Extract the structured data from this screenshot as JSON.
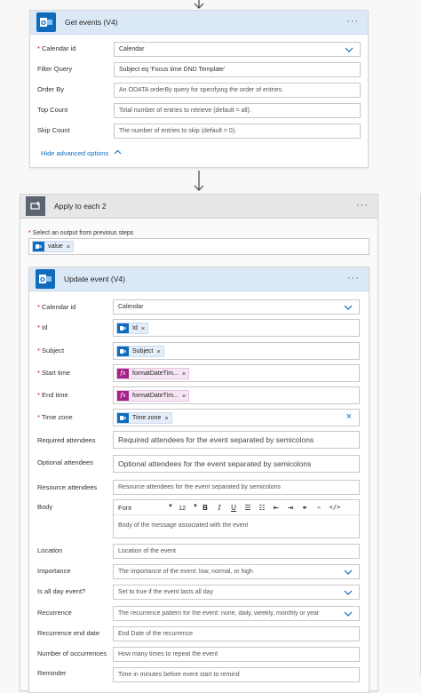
{
  "get_events": {
    "title": "Get events (V4)",
    "fields": [
      {
        "label": "Calendar id",
        "required": true,
        "value": "Calendar"
      },
      {
        "label": "Filter Query",
        "value": "Subject eq 'Focus time DND Template'"
      },
      {
        "label": "Order By",
        "placeholder": "An ODATA orderBy query for specifying the order of entries."
      },
      {
        "label": "Top Count",
        "placeholder": "Total number of entries to retrieve (default = all)."
      },
      {
        "label": "Skip Count",
        "placeholder": "The number of entries to skip (default = 0)."
      }
    ],
    "hide_advanced": "Hide advanced options"
  },
  "apply_each": {
    "title": "Apply to each 2",
    "select_label": "Select an output from previous steps",
    "token": "value"
  },
  "update_event": {
    "title": "Update event (V4)",
    "calendar_id": {
      "label": "Calendar id",
      "value": "Calendar"
    },
    "id": {
      "label": "Id",
      "token": "Id"
    },
    "subject": {
      "label": "Subject",
      "token": "Subject"
    },
    "start_time": {
      "label": "Start time",
      "token": "formatDateTim..."
    },
    "end_time": {
      "label": "End time",
      "token": "formatDateTim..."
    },
    "time_zone": {
      "label": "Time zone",
      "token": "Time zone"
    },
    "required_attendees": {
      "label": "Required attendees",
      "placeholder": "Required attendees for the event separated by semicolons"
    },
    "optional_attendees": {
      "label": "Optional attendees",
      "placeholder": "Optional attendees for the event separated by semicolons"
    },
    "resource_attendees": {
      "label": "Resource attendees",
      "placeholder": "Resource attendees for the event separated by semicolons"
    },
    "body": {
      "label": "Body",
      "font": "Font",
      "size": "12",
      "placeholder": "Body of the message associated with the event"
    },
    "location": {
      "label": "Location",
      "placeholder": "Location of the event"
    },
    "importance": {
      "label": "Importance",
      "placeholder": "The importance of the event: low, normal, or high"
    },
    "all_day": {
      "label": "Is all day event?",
      "placeholder": "Set to true if the event lasts all day"
    },
    "recurrence": {
      "label": "Recurrence",
      "placeholder": "The recurrence pattern for the event: none, daily, weekly, monthly or year"
    },
    "recurrence_end": {
      "label": "Recurrence end date",
      "placeholder": "End Date of the recurrence"
    },
    "occurrences": {
      "label": "Number of occurrences",
      "placeholder": "How many times to repeat the event"
    },
    "reminder": {
      "label": "Reminder",
      "placeholder": "Time in minutes before event start to remind"
    }
  },
  "colors": {
    "accent": "#0f6cbd",
    "header_blue": "#dbe9f7",
    "expression": "#a32287"
  }
}
